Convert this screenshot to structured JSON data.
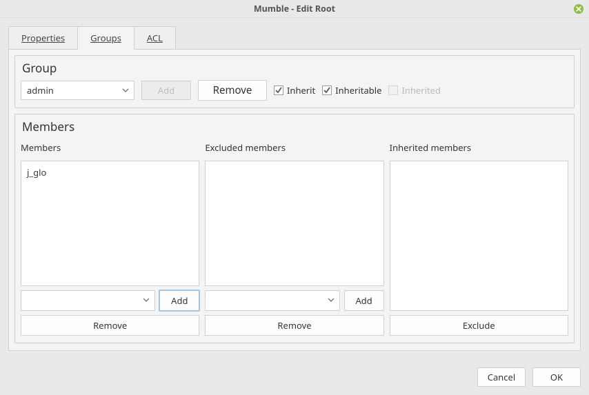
{
  "title": "Mumble - Edit Root",
  "tabs": {
    "properties": "Properties",
    "groups": "Groups",
    "acl": "ACL"
  },
  "group_panel": {
    "title": "Group",
    "selected": "admin",
    "add_label": "Add",
    "remove_label": "Remove",
    "inherit_label": "Inherit",
    "inheritable_label": "Inheritable",
    "inherited_label": "Inherited",
    "inherit_checked": true,
    "inheritable_checked": true,
    "inherited_checked": false
  },
  "members_panel": {
    "title": "Members",
    "members_label": "Members",
    "excluded_label": "Excluded members",
    "inherited_label": "Inherited members",
    "members_list": [
      "j_glo"
    ],
    "excluded_list": [],
    "inherited_list": [],
    "add_label": "Add",
    "remove_label": "Remove",
    "exclude_label": "Exclude"
  },
  "footer": {
    "cancel": "Cancel",
    "ok": "OK"
  }
}
